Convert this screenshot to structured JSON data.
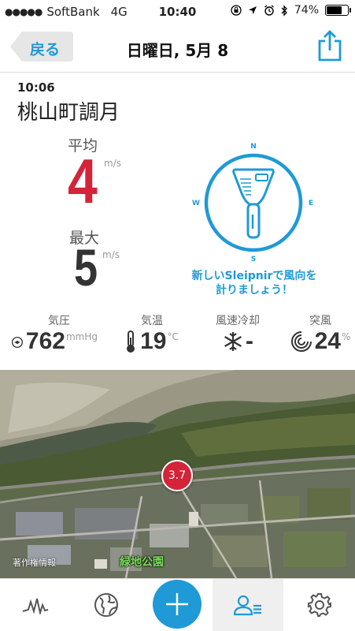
{
  "status_bar": {
    "carrier": "SoftBank",
    "network": "4G",
    "time": "10:40",
    "battery": "74%",
    "battery_level": 0.74
  },
  "nav": {
    "back_label": "戻る",
    "title": "日曜日, 5月 8"
  },
  "report": {
    "time": "10:06",
    "location": "桃山町調月",
    "avg_label": "平均",
    "avg_value": "4",
    "avg_unit": "m/s",
    "max_label": "最大",
    "max_value": "5",
    "max_unit": "m/s"
  },
  "compass": {
    "n": "N",
    "e": "E",
    "s": "S",
    "w": "W"
  },
  "promo": {
    "line1": "新しいSleipnirで風向を",
    "line2": "計りましょう！"
  },
  "stats": [
    {
      "label": "気圧",
      "value": "762",
      "unit": "mmHg",
      "icon": "pressure-icon"
    },
    {
      "label": "気温",
      "value": "19",
      "unit": "°C",
      "icon": "thermometer-icon"
    },
    {
      "label": "風速冷却",
      "value": "-",
      "unit": "",
      "icon": "snowflake-icon"
    },
    {
      "label": "突風",
      "value": "24",
      "unit": "%",
      "icon": "gust-icon"
    }
  ],
  "map": {
    "marker": "3.7",
    "copyright": "著作権情報",
    "place_label": "緑地公園"
  },
  "tabs": [
    {
      "name": "tab-graph",
      "icon": "graph-icon"
    },
    {
      "name": "tab-globe",
      "icon": "globe-icon"
    },
    {
      "name": "add-button",
      "icon": "plus-icon"
    },
    {
      "name": "tab-profile",
      "icon": "profile-list-icon",
      "active": true
    },
    {
      "name": "tab-settings",
      "icon": "gear-icon"
    }
  ],
  "colors": {
    "accent": "#1f9ad6",
    "wind_avg": "#d4243a",
    "marker": "#d4243a"
  }
}
